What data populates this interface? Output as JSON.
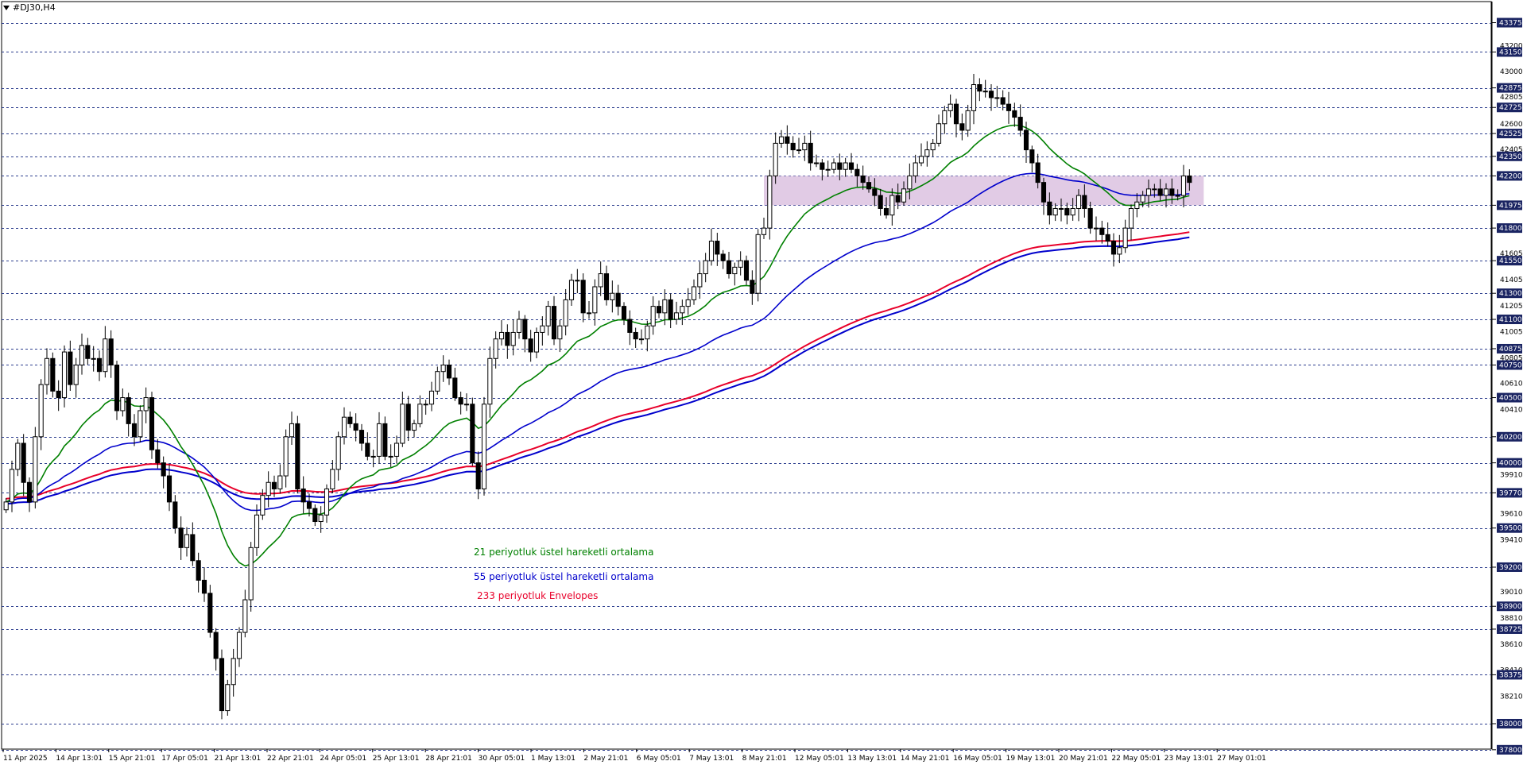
{
  "window": {
    "title": "#DJ30,H4"
  },
  "icons": {
    "menu_triangle": "triangle-down-icon"
  },
  "colors": {
    "background": "#ffffff",
    "grid": "#2e3f8f",
    "ema21": "#008000",
    "ema55": "#0000cc",
    "envelopes": "#e8002a",
    "zone_fill": "#d7b9dc",
    "axis_highlight_bg": "#1a2462",
    "candle_up": "#ffffff",
    "candle_down": "#000000"
  },
  "legend": {
    "ema21": "21 periyotluk üstel hareketli ortalama",
    "ema55": "55 periyotluk üstel hareketli ortalama",
    "envelopes": "233 periyotluk Envelopes"
  },
  "chart_data": {
    "type": "candlestick",
    "symbol": "#DJ30",
    "timeframe": "H4",
    "grid": true,
    "ylim": [
      37800,
      43500
    ],
    "y_ticks_highlighted": [
      43375,
      43150,
      42875,
      42725,
      42525,
      42350,
      42200,
      41975,
      41800,
      41550,
      41300,
      41100,
      40875,
      40750,
      40500,
      40200,
      40000,
      39770,
      39500,
      39200,
      38900,
      38725,
      38375,
      38000,
      37800
    ],
    "y_ticks_plain": [
      43200,
      43000,
      42805,
      42600,
      42405,
      41605,
      41405,
      41205,
      41005,
      40805,
      40610,
      40410,
      39910,
      39610,
      39410,
      39010,
      38810,
      38610,
      38410,
      38210
    ],
    "x_ticks": [
      "11 Apr 2025",
      "14 Apr 13:01",
      "15 Apr 21:01",
      "17 Apr 05:01",
      "21 Apr 13:01",
      "22 Apr 21:01",
      "24 Apr 05:01",
      "25 Apr 13:01",
      "28 Apr 21:01",
      "30 Apr 05:01",
      "1 May 13:01",
      "2 May 21:01",
      "6 May 05:01",
      "7 May 13:01",
      "8 May 21:01",
      "12 May 05:01",
      "13 May 13:01",
      "14 May 21:01",
      "16 May 05:01",
      "19 May 13:01",
      "20 May 21:01",
      "22 May 05:01",
      "23 May 13:01",
      "27 May 01:01"
    ],
    "bar_count": 275,
    "closes": [
      39700,
      39950,
      40150,
      39850,
      39700,
      40200,
      40600,
      40800,
      40550,
      40500,
      40850,
      40600,
      40750,
      40900,
      40800,
      40800,
      40700,
      40950,
      40750,
      40400,
      40500,
      40300,
      40200,
      40400,
      40500,
      40100,
      40000,
      39900,
      39700,
      39500,
      39350,
      39450,
      39250,
      39100,
      39000,
      38700,
      38500,
      38100,
      38300,
      38500,
      38700,
      38950,
      39350,
      39600,
      39750,
      39850,
      39800,
      39900,
      40200,
      40300,
      39800,
      39700,
      39650,
      39550,
      39600,
      39800,
      39950,
      40200,
      40350,
      40300,
      40250,
      40150,
      40050,
      40050,
      40300,
      40050,
      40050,
      40150,
      40450,
      40250,
      40300,
      40450,
      40450,
      40550,
      40700,
      40750,
      40650,
      40500,
      40450,
      40450,
      40000,
      39800,
      40450,
      40800,
      40950,
      41000,
      40900,
      41000,
      41100,
      40950,
      40850,
      41000,
      41050,
      41200,
      40950,
      41050,
      41250,
      41400,
      41400,
      41150,
      41150,
      41350,
      41450,
      41250,
      41300,
      41200,
      41100,
      41000,
      40950,
      40950,
      41050,
      41200,
      41150,
      41250,
      41100,
      41150,
      41200,
      41250,
      41350,
      41450,
      41550,
      41700,
      41600,
      41550,
      41450,
      41500,
      41550,
      41400,
      41300,
      41750,
      41800,
      42200,
      42450,
      42500,
      42450,
      42400,
      42400,
      42450,
      42300,
      42300,
      42250,
      42250,
      42300,
      42250,
      42300,
      42250,
      42200,
      42150,
      42100,
      42050,
      41950,
      41900,
      42050,
      42000,
      42100,
      42200,
      42300,
      42350,
      42400,
      42450,
      42600,
      42700,
      42750,
      42600,
      42550,
      42700,
      42900,
      42850,
      42850,
      42800,
      42800,
      42750,
      42700,
      42650,
      42550,
      42400,
      42300,
      42150,
      42000,
      41900,
      41950,
      41950,
      41900,
      41950,
      42050,
      41950,
      41800,
      41800,
      41750,
      41700,
      41600,
      41650,
      41800,
      41950,
      42000,
      42050,
      42100,
      42100,
      42050,
      42100,
      42050,
      42050,
      42200,
      42150
    ]
  }
}
